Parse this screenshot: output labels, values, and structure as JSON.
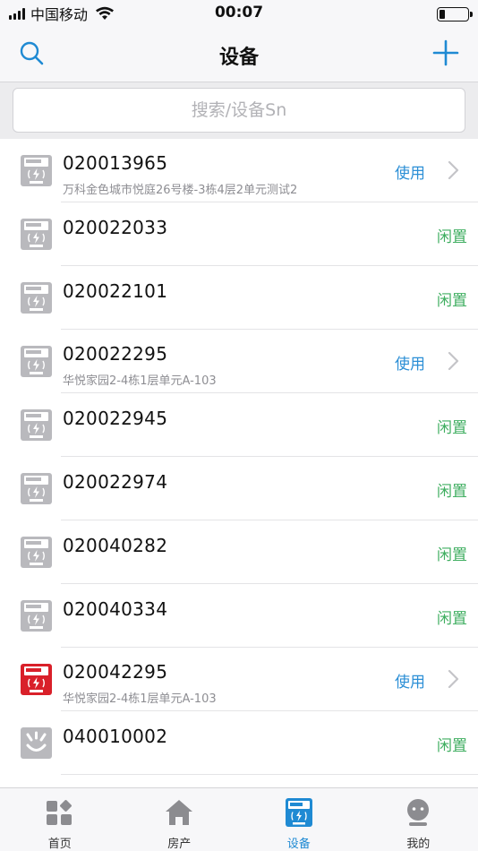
{
  "status_bar": {
    "carrier": "中国移动",
    "time": "00:07",
    "battery_level": 0.2
  },
  "nav": {
    "title": "设备",
    "left_icon": "search-icon",
    "right_icon": "plus-icon",
    "accent_color": "#1f8ad3"
  },
  "search": {
    "placeholder": "搜索/设备Sn"
  },
  "devices": [
    {
      "sn": "020013965",
      "address": "万科金色城市悦庭26号楼-3栋4层2单元测试2",
      "status": "使用",
      "icon": "meter-icon",
      "has_chevron": true
    },
    {
      "sn": "020022033",
      "address": "",
      "status": "闲置",
      "icon": "meter-icon",
      "has_chevron": false
    },
    {
      "sn": "020022101",
      "address": "",
      "status": "闲置",
      "icon": "meter-icon",
      "has_chevron": false
    },
    {
      "sn": "020022295",
      "address": "华悦家园2-4栋1层单元A-103",
      "status": "使用",
      "icon": "meter-icon",
      "has_chevron": true
    },
    {
      "sn": "020022945",
      "address": "",
      "status": "闲置",
      "icon": "meter-icon",
      "has_chevron": false
    },
    {
      "sn": "020022974",
      "address": "",
      "status": "闲置",
      "icon": "meter-icon",
      "has_chevron": false
    },
    {
      "sn": "020040282",
      "address": "",
      "status": "闲置",
      "icon": "meter-icon",
      "has_chevron": false
    },
    {
      "sn": "020040334",
      "address": "",
      "status": "闲置",
      "icon": "meter-icon",
      "has_chevron": false
    },
    {
      "sn": "020042295",
      "address": "华悦家园2-4栋1层单元A-103",
      "status": "使用",
      "icon": "meter-alert-icon",
      "has_chevron": true
    },
    {
      "sn": "040010002",
      "address": "",
      "status": "闲置",
      "icon": "socket-icon",
      "has_chevron": false
    }
  ],
  "status_colors": {
    "使用": "#2c8fd6",
    "闲置": "#3fae60"
  },
  "tabs": [
    {
      "label": "首页",
      "icon": "home-grid-icon",
      "active": false
    },
    {
      "label": "房产",
      "icon": "house-icon",
      "active": false
    },
    {
      "label": "设备",
      "icon": "device-meter-icon",
      "active": true
    },
    {
      "label": "我的",
      "icon": "profile-icon",
      "active": false
    }
  ]
}
